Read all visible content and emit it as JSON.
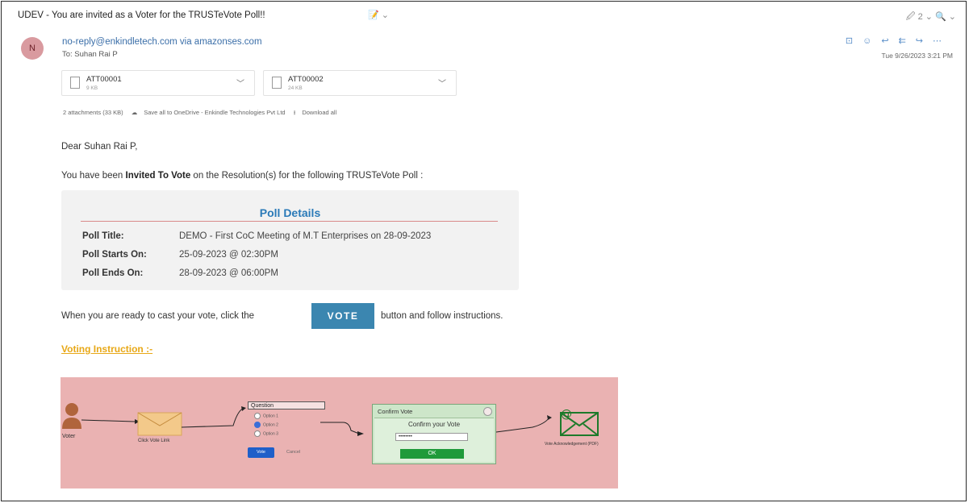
{
  "email": {
    "subject": "UDEV - You are invited as a Voter for the TRUSTeVote Poll!!",
    "subject_tools": "📝 ⌄",
    "right_tools": "🖉 2 ⌄   🔍 ⌄",
    "avatar_initial": "N",
    "sender": "no-reply@enkindletech.com via amazonses.com",
    "to": "To: Suhan Rai P",
    "date": "Tue 9/26/2023 3:21 PM"
  },
  "attachments": [
    {
      "name": "ATT00001",
      "size": "9 KB"
    },
    {
      "name": "ATT00002",
      "size": "24 KB"
    }
  ],
  "attachment_summary": {
    "count": "2 attachments (33 KB)",
    "save": "Save all to OneDrive - Enkindle Technologies Pvt Ltd",
    "download": "Download all"
  },
  "body": {
    "greeting": "Dear Suhan Rai P,",
    "intro_pre": "You have been ",
    "intro_bold": "Invited To Vote",
    "intro_post": " on the Resolution(s) for the following TRUSTeVote Poll :",
    "ready_pre": "When you are ready to cast your vote, click the",
    "vote_button": "VOTE",
    "ready_post": "button and follow instructions.",
    "voting_instruction": "Voting Instruction :-"
  },
  "poll": {
    "heading": "Poll Details",
    "rows": [
      {
        "label": "Poll Title:",
        "value": "DEMO - First CoC Meeting of M.T Enterprises on 28-09-2023"
      },
      {
        "label": "Poll Starts On:",
        "value": "25-09-2023 @ 02:30PM"
      },
      {
        "label": "Poll Ends On:",
        "value": "28-09-2023 @ 06:00PM"
      }
    ]
  },
  "diagram": {
    "voter": "Voter",
    "click_vote_link": "Click Vote Link",
    "question": "Question",
    "options": [
      "Option 1",
      "Option 2",
      "Option 3"
    ],
    "vote": "Vote",
    "cancel": "Cancel",
    "confirm_title": "Confirm Vote",
    "confirm_sub": "Confirm your Vote",
    "confirm_field": "••••••••",
    "ok": "OK",
    "vote_ack": "Vote Acknowledgement (PDF)"
  },
  "colors": {
    "accent_blue": "#2a7ab8",
    "vote_button": "#3b86b0",
    "instruction_orange": "#e8a817",
    "diagram_bg": "#eab2b2"
  }
}
